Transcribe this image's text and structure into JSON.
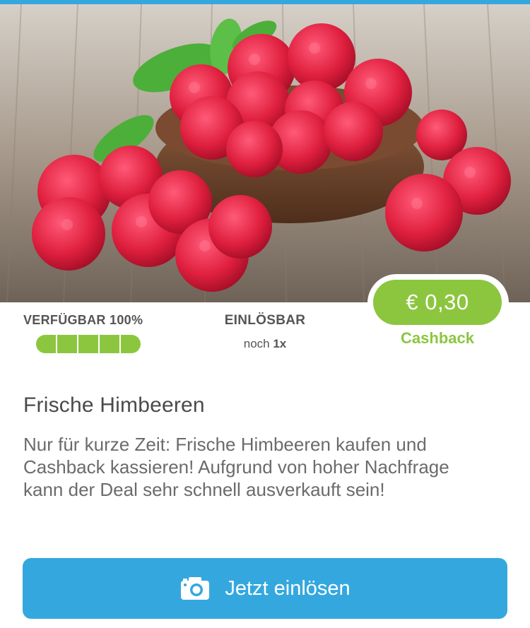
{
  "colors": {
    "accent_blue": "#34a8de",
    "accent_green": "#8cc63f",
    "title_text": "#4a4a4a",
    "body_text": "#6b6b6b"
  },
  "hero": {
    "image": "raspberries-in-wooden-bowl"
  },
  "availability": {
    "label": "VERFÜGBAR",
    "value": "100%",
    "fraction": 1.0,
    "segments": 5
  },
  "redeemable": {
    "label": "EINLÖSBAR",
    "prefix": "noch",
    "count": "1x"
  },
  "cashback": {
    "amount": "€ 0,30",
    "label": "Cashback"
  },
  "deal": {
    "title": "Frische Himbeeren",
    "description": "Nur für kurze Zeit: Frische Himbeeren kaufen und Cashback kassieren! Aufgrund von hoher Nachfrage kann der Deal sehr schnell ausverkauft sein!"
  },
  "cta": {
    "label": "Jetzt einlösen",
    "icon": "camera-icon"
  }
}
